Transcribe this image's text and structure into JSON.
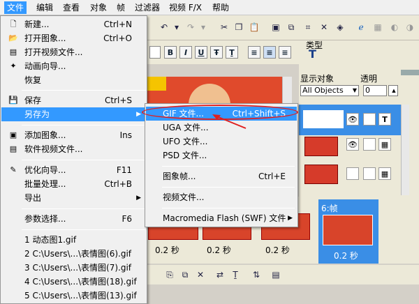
{
  "menubar": {
    "items": [
      {
        "label": "文件"
      },
      {
        "label": "编辑"
      },
      {
        "label": "查看"
      },
      {
        "label": "对象"
      },
      {
        "label": "帧"
      },
      {
        "label": "过滤器"
      },
      {
        "label": "视频 F/X"
      },
      {
        "label": "帮助"
      }
    ]
  },
  "toolbar": {
    "type_label": "类型",
    "type_icon_text": "T"
  },
  "right_panel": {
    "show_objects_label": "显示对象",
    "opacity_label": "透明",
    "objects_select": "All Objects",
    "opacity_value": "0"
  },
  "frames": [
    {
      "caption": "0.2 秒"
    },
    {
      "caption": "0.2 秒"
    },
    {
      "caption": "0.2 秒"
    },
    {
      "caption": "0.2 秒",
      "title": "6:帧"
    }
  ],
  "file_menu": {
    "items": [
      {
        "label": "新建...",
        "shortcut": "Ctrl+N"
      },
      {
        "label": "打开图象...",
        "shortcut": "Ctrl+O"
      },
      {
        "label": "打开视频文件...",
        "shortcut": ""
      },
      {
        "label": "动画向导...",
        "shortcut": ""
      },
      {
        "label": "恢复",
        "shortcut": ""
      },
      {
        "label": "保存",
        "shortcut": "Ctrl+S"
      },
      {
        "label": "另存为",
        "shortcut": ""
      },
      {
        "label": "添加图象...",
        "shortcut": "Ins"
      },
      {
        "label": "软件视频文件...",
        "shortcut": ""
      },
      {
        "label": "优化向导...",
        "shortcut": "F11"
      },
      {
        "label": "批量处理...",
        "shortcut": "Ctrl+B"
      },
      {
        "label": "导出",
        "shortcut": ""
      },
      {
        "label": "参数选择...",
        "shortcut": "F6"
      },
      {
        "label": "1 动态图1.gif",
        "shortcut": ""
      },
      {
        "label": "2 C:\\Users\\...\\表情图(6).gif",
        "shortcut": ""
      },
      {
        "label": "3 C:\\Users\\...\\表情图(7).gif",
        "shortcut": ""
      },
      {
        "label": "4 C:\\Users\\...\\表情图(18).gif",
        "shortcut": ""
      },
      {
        "label": "5 C:\\Users\\...\\表情图(13).gif",
        "shortcut": ""
      }
    ]
  },
  "save_as_menu": {
    "items": [
      {
        "label": "GIF 文件...",
        "shortcut": "Ctrl+Shift+S"
      },
      {
        "label": "UGA 文件...",
        "shortcut": ""
      },
      {
        "label": "UFO 文件...",
        "shortcut": ""
      },
      {
        "label": "PSD 文件...",
        "shortcut": ""
      },
      {
        "label": "图象帧...",
        "shortcut": "Ctrl+E"
      },
      {
        "label": "视频文件...",
        "shortcut": ""
      },
      {
        "label": "Macromedia Flash (SWF) 文件",
        "shortcut": ""
      }
    ]
  },
  "colors": {
    "highlight": "#3399ff",
    "annotation": "#e02020"
  }
}
